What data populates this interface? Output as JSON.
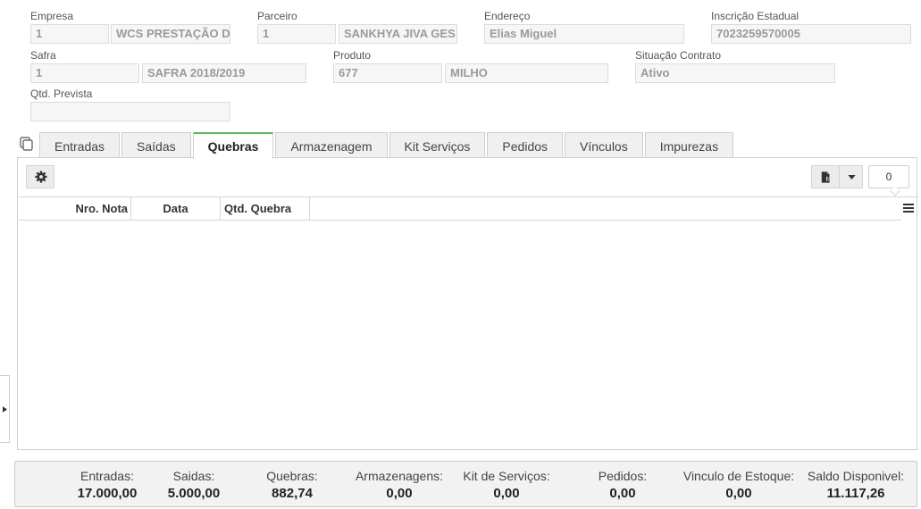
{
  "form": {
    "empresa": {
      "label": "Empresa",
      "code": "1",
      "name": "WCS PRESTAÇÃO D"
    },
    "parceiro": {
      "label": "Parceiro",
      "code": "1",
      "name": "SANKHYA JIVA GES"
    },
    "endereco": {
      "label": "Endereço",
      "value": "Elias Miguel"
    },
    "inscricao": {
      "label": "Inscrição Estadual",
      "value": "7023259570005"
    },
    "safra": {
      "label": "Safra",
      "code": "1",
      "name": "SAFRA 2018/2019"
    },
    "produto": {
      "label": "Produto",
      "code": "677",
      "name": "MILHO"
    },
    "situacao": {
      "label": "Situação Contrato",
      "value": "Ativo"
    },
    "qtd_prevista": {
      "label": "Qtd. Prevista",
      "value": ""
    }
  },
  "tabs": [
    {
      "label": "Entradas",
      "active": false
    },
    {
      "label": "Saídas",
      "active": false
    },
    {
      "label": "Quebras",
      "active": true
    },
    {
      "label": "Armazenagem",
      "active": false
    },
    {
      "label": "Kit Serviços",
      "active": false
    },
    {
      "label": "Pedidos",
      "active": false
    },
    {
      "label": "Vínculos",
      "active": false
    },
    {
      "label": "Impurezas",
      "active": false
    }
  ],
  "toolbar": {
    "settings_icon": "gear-icon",
    "export_icon": "export-document-icon",
    "dropdown_icon": "caret-down-icon",
    "record_count": "0"
  },
  "grid": {
    "columns": [
      "Nro. Nota",
      "Data",
      "Qtd. Quebra"
    ],
    "rows": []
  },
  "footer": [
    {
      "title": "Entradas:",
      "value": "17.000,00"
    },
    {
      "title": "Saidas:",
      "value": "5.000,00"
    },
    {
      "title": "Quebras:",
      "value": "882,74"
    },
    {
      "title": "Armazenagens:",
      "value": "0,00"
    },
    {
      "title": "Kit de Serviços:",
      "value": "0,00"
    },
    {
      "title": "Pedidos:",
      "value": "0,00"
    },
    {
      "title": "Vinculo de Estoque:",
      "value": "0,00"
    },
    {
      "title": "Saldo Disponivel:",
      "value": "11.117,26"
    }
  ],
  "colors": {
    "active_tab_accent": "#5cb85c",
    "field_bg": "#f6f6f6",
    "footer_bg": "#f2f2f2"
  }
}
